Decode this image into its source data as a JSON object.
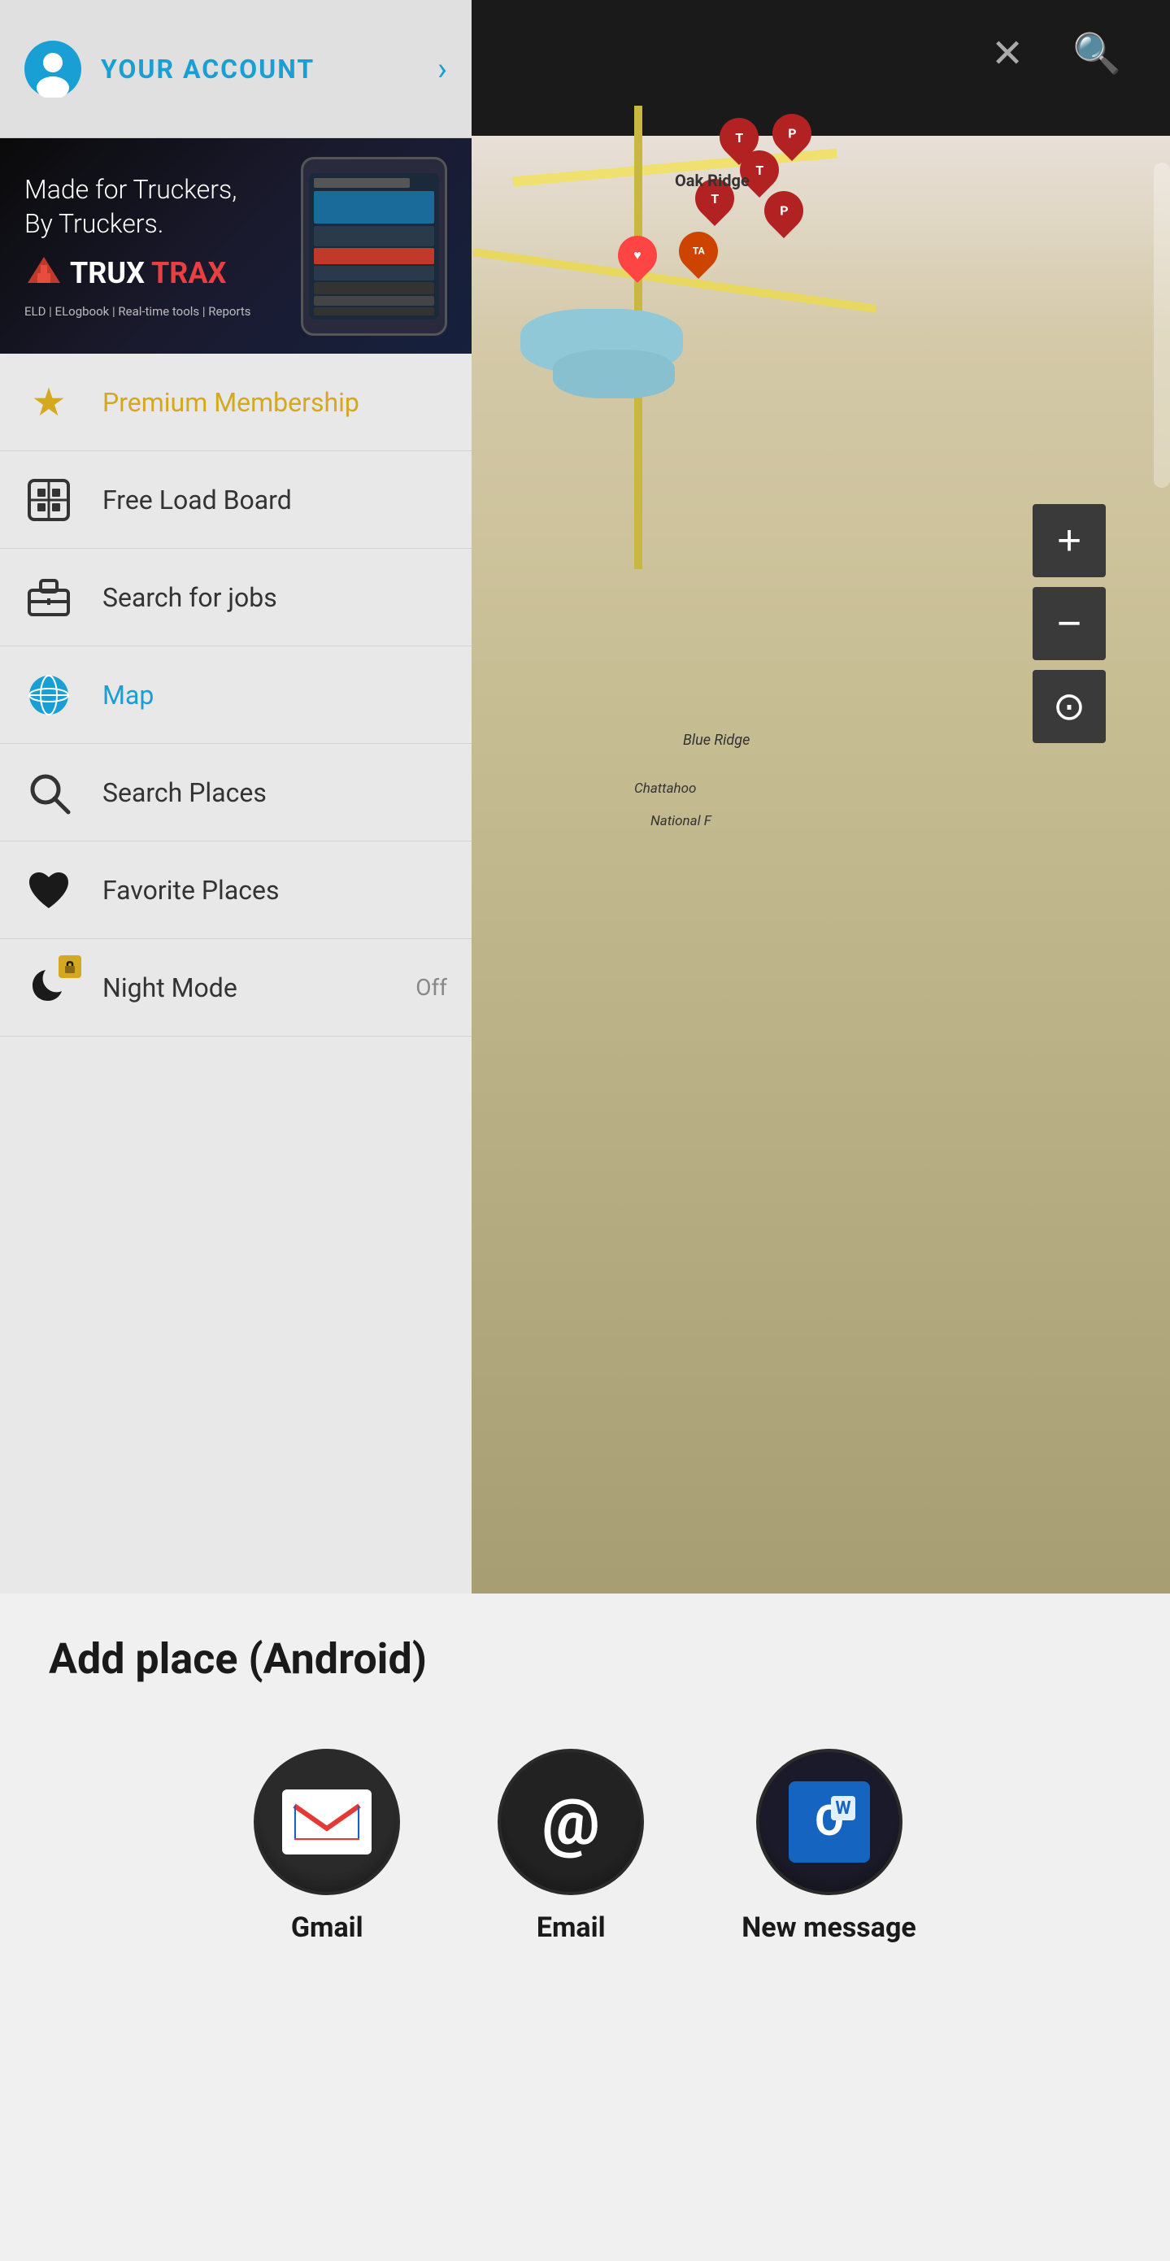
{
  "account": {
    "label": "YOUR ACCOUNT",
    "chevron": "›"
  },
  "ad": {
    "tagline": "Made for Truckers,\nBy Truckers.",
    "logo_trux": "TRUX",
    "logo_trax": "TRAX",
    "sub": "ELD | ELogbook | Real-time tools | Reports"
  },
  "menu": {
    "items": [
      {
        "id": "premium",
        "label": "Premium Membership",
        "color": "gold"
      },
      {
        "id": "loadboard",
        "label": "Free Load Board",
        "color": "dark"
      },
      {
        "id": "jobs",
        "label": "Search for jobs",
        "color": "dark"
      },
      {
        "id": "map",
        "label": "Map",
        "color": "blue"
      },
      {
        "id": "search-places",
        "label": "Search Places",
        "color": "dark"
      },
      {
        "id": "favorite",
        "label": "Favorite Places",
        "color": "dark"
      },
      {
        "id": "nightmode",
        "label": "Night Mode",
        "color": "dark",
        "badge": "Off"
      }
    ]
  },
  "map": {
    "labels": {
      "oak_ridge": "Oak Ridge",
      "blue_ridge": "Blue Ridge",
      "chattahoochee": "Chattahoo",
      "national": "National F"
    }
  },
  "bottom": {
    "title": "Add place (Android)",
    "apps": [
      {
        "id": "gmail",
        "label": "Gmail"
      },
      {
        "id": "email",
        "label": "Email"
      },
      {
        "id": "newmessage",
        "label": "New message"
      }
    ]
  },
  "icons": {
    "account": "person",
    "star": "★",
    "loadboard": "⊞",
    "briefcase": "💼",
    "globe": "🌐",
    "search": "🔍",
    "heart": "♥",
    "moon": "🌙",
    "lock": "🔒",
    "plus": "+",
    "minus": "−",
    "locator": "⊙",
    "satellite": "✕",
    "magnifier": "🔍"
  },
  "colors": {
    "accent_blue": "#1a9fd4",
    "accent_gold": "#d4a820",
    "dark_bg": "#1a1a1a",
    "sidebar_bg": "#e8e8e8",
    "menu_divider": "#d0d0d0"
  }
}
